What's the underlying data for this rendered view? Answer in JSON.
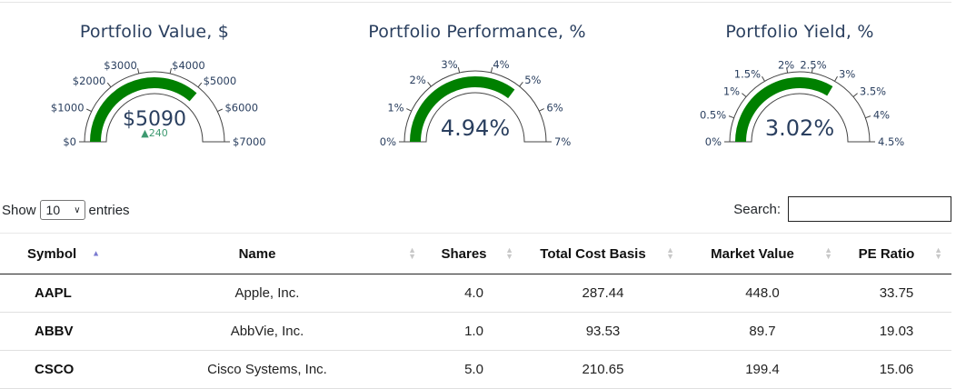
{
  "gauges": [
    {
      "title": "Portfolio Value, $",
      "value": 5090,
      "value_text": "$5090",
      "delta": 240,
      "delta_text": "▲240",
      "range": [
        0,
        7000
      ],
      "ticks": [
        "$0",
        "$1000",
        "$2000",
        "$3000",
        "$4000",
        "$5000",
        "$6000",
        "$7000"
      ],
      "bar_color": "#008000"
    },
    {
      "title": "Portfolio Performance, %",
      "value": 4.94,
      "value_text": "4.94%",
      "range": [
        0,
        7
      ],
      "ticks": [
        "0%",
        "1%",
        "2%",
        "3%",
        "4%",
        "5%",
        "6%",
        "7%"
      ],
      "bar_color": "#008000"
    },
    {
      "title": "Portfolio Yield, %",
      "value": 3.02,
      "value_text": "3.02%",
      "range": [
        0,
        4.5
      ],
      "ticks": [
        "0%",
        "0.5%",
        "1%",
        "1.5%",
        "2%",
        "2.5%",
        "3%",
        "3.5%",
        "4%",
        "4.5%"
      ],
      "bar_color": "#008000"
    }
  ],
  "controls": {
    "show_label": "Show",
    "entries_value": "10",
    "entries_label": "entries",
    "search_label": "Search:",
    "search_value": ""
  },
  "table": {
    "columns": [
      "Symbol",
      "Name",
      "Shares",
      "Total Cost Basis",
      "Market Value",
      "PE Ratio"
    ],
    "rows": [
      [
        "AAPL",
        "Apple, Inc.",
        "4.0",
        "287.44",
        "448.0",
        "33.75"
      ],
      [
        "ABBV",
        "AbbVie, Inc.",
        "1.0",
        "93.53",
        "89.7",
        "19.03"
      ],
      [
        "CSCO",
        "Cisco Systems, Inc.",
        "5.0",
        "210.65",
        "199.4",
        "15.06"
      ]
    ]
  },
  "colors": {
    "gauge_bar": "#008000",
    "gauge_text": "#2a3f5f",
    "delta_up": "#3d9970",
    "sort_active": "#7a7ad0"
  }
}
